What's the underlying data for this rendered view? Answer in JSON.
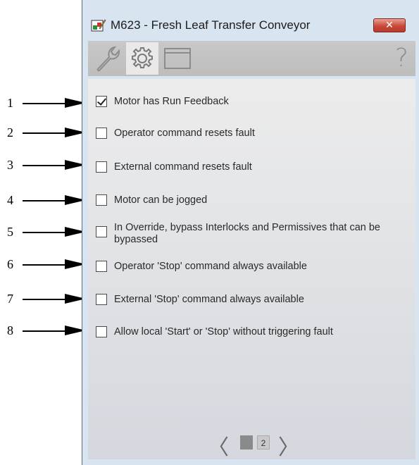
{
  "window": {
    "title": "M623 - Fresh Leaf Transfer Conveyor",
    "close_label": "✕"
  },
  "toolbar": {
    "tabs": [
      {
        "icon": "wrench-icon",
        "active": false
      },
      {
        "icon": "gear-icon",
        "active": true
      },
      {
        "icon": "window-icon",
        "active": false
      }
    ],
    "help_label": "?"
  },
  "callouts": [
    "1",
    "2",
    "3",
    "4",
    "5",
    "6",
    "7",
    "8"
  ],
  "options": [
    {
      "label": "Motor has Run Feedback",
      "checked": true
    },
    {
      "label": "Operator command resets fault",
      "checked": false
    },
    {
      "label": "External command resets fault",
      "checked": false
    },
    {
      "label": "Motor can be jogged",
      "checked": false
    },
    {
      "label": "In Override, bypass Interlocks and Permissives that can be bypassed",
      "checked": false
    },
    {
      "label": "Operator 'Stop' command always available",
      "checked": false
    },
    {
      "label": "External 'Stop' command always available",
      "checked": false
    },
    {
      "label": "Allow local 'Start' or 'Stop' without triggering fault",
      "checked": false
    }
  ],
  "pager": {
    "prev": "〈",
    "next": "〉",
    "pages": [
      "1",
      "2"
    ],
    "current": "1"
  }
}
